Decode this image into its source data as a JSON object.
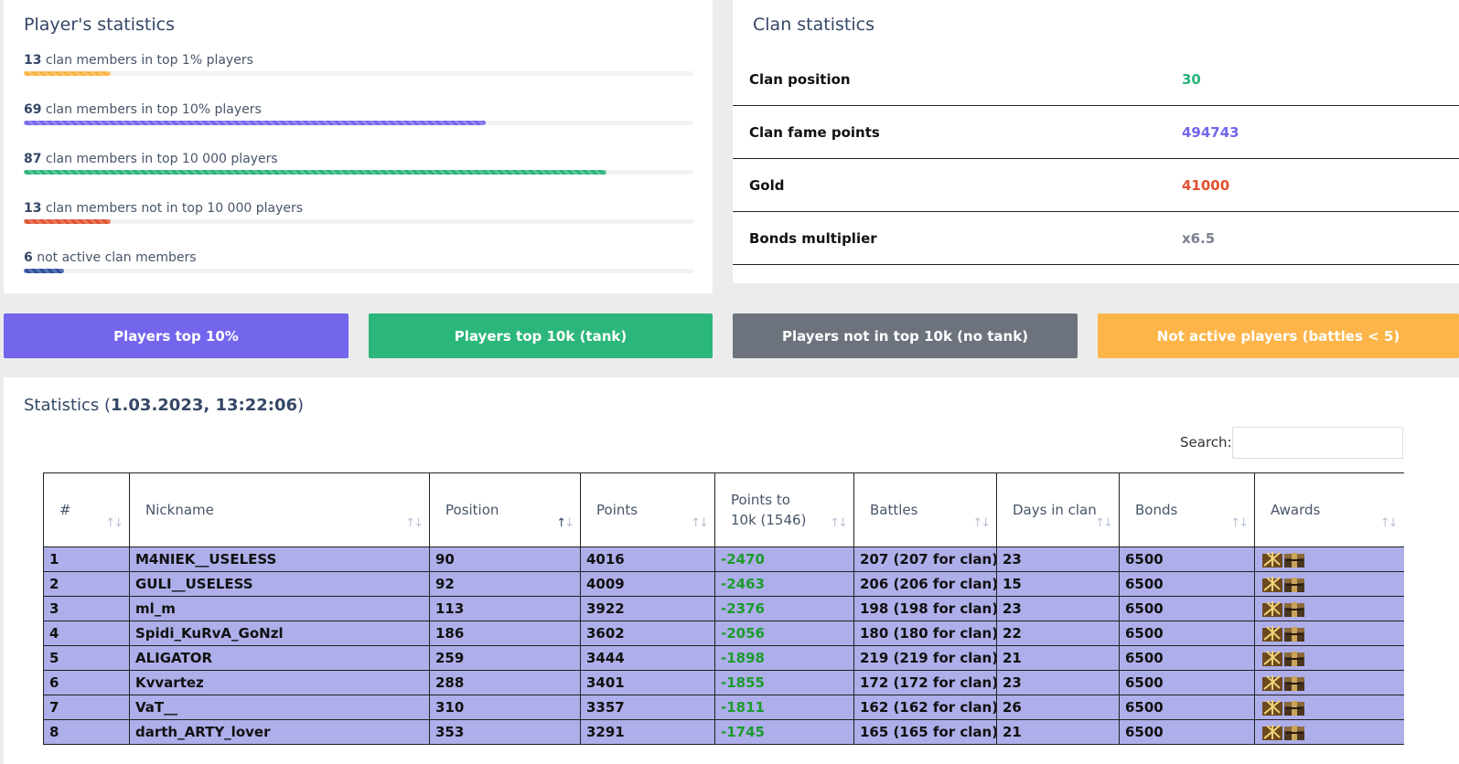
{
  "players_card": {
    "title": "Player's statistics",
    "rows": [
      {
        "count": "13",
        "text": " clan members in top 1% players",
        "fraction": 0.13,
        "color": "#fbb140"
      },
      {
        "count": "69",
        "text": " clan members in top 10% players",
        "fraction": 0.69,
        "color": "#7366ed"
      },
      {
        "count": "87",
        "text": " clan members in top 10 000 players",
        "fraction": 0.87,
        "color": "#2bb37a"
      },
      {
        "count": "13",
        "text": " clan members not in top 10 000 players",
        "fraction": 0.13,
        "color": "#e0512e"
      },
      {
        "count": "6",
        "text": " not active clan members",
        "fraction": 0.06,
        "color": "#2d4f9b"
      }
    ]
  },
  "clan_card": {
    "title": "Clan statistics",
    "rows": [
      {
        "key": "Clan position",
        "value": "30",
        "color": "#2bb37a"
      },
      {
        "key": "Clan fame points",
        "value": "494743",
        "color": "#7366ed"
      },
      {
        "key": "Gold",
        "value": "41000",
        "color": "#e0512e"
      },
      {
        "key": "Bonds multiplier",
        "value": "x6.5",
        "color": "#7b8290"
      }
    ]
  },
  "buttons": [
    {
      "label": "Players top 10%",
      "color": "#7366ed"
    },
    {
      "label": "Players top 10k (tank)",
      "color": "#2bb77b"
    },
    {
      "label": "Players not in top 10k (no tank)",
      "color": "#6c737d"
    },
    {
      "label": "Not active players (battles < 5)",
      "color": "#fdb54a"
    }
  ],
  "stats": {
    "title_prefix": "Statistics (",
    "timestamp": "1.03.2023, 13:22:06",
    "title_suffix": ")",
    "search_label": "Search:",
    "search_value": "",
    "columns": [
      "#",
      "Nickname",
      "Position",
      "Points",
      "Points to 10k (1546)",
      "Battles",
      "Days in clan",
      "Bonds",
      "Awards"
    ],
    "sorted_column": "Position",
    "rows": [
      {
        "n": "1",
        "nick": "M4NIEK__USELESS",
        "pos": "90",
        "points": "4016",
        "to10k": "-2470",
        "battles": "207 (207 for clan)",
        "days": "23",
        "bonds": "6500"
      },
      {
        "n": "2",
        "nick": "GULI__USELESS",
        "pos": "92",
        "points": "4009",
        "to10k": "-2463",
        "battles": "206 (206 for clan)",
        "days": "15",
        "bonds": "6500"
      },
      {
        "n": "3",
        "nick": "ml_m",
        "pos": "113",
        "points": "3922",
        "to10k": "-2376",
        "battles": "198 (198 for clan)",
        "days": "23",
        "bonds": "6500"
      },
      {
        "n": "4",
        "nick": "Spidi_KuRvA_GoNzl",
        "pos": "186",
        "points": "3602",
        "to10k": "-2056",
        "battles": "180 (180 for clan)",
        "days": "22",
        "bonds": "6500"
      },
      {
        "n": "5",
        "nick": "ALIGATOR",
        "pos": "259",
        "points": "3444",
        "to10k": "-1898",
        "battles": "219 (219 for clan)",
        "days": "21",
        "bonds": "6500"
      },
      {
        "n": "6",
        "nick": "Kvvartez",
        "pos": "288",
        "points": "3401",
        "to10k": "-1855",
        "battles": "172 (172 for clan)",
        "days": "23",
        "bonds": "6500"
      },
      {
        "n": "7",
        "nick": "VaT__",
        "pos": "310",
        "points": "3357",
        "to10k": "-1811",
        "battles": "162 (162 for clan)",
        "days": "26",
        "bonds": "6500"
      },
      {
        "n": "8",
        "nick": "darth_ARTY_lover",
        "pos": "353",
        "points": "3291",
        "to10k": "-1745",
        "battles": "165 (165 for clan)",
        "days": "21",
        "bonds": "6500"
      }
    ]
  }
}
